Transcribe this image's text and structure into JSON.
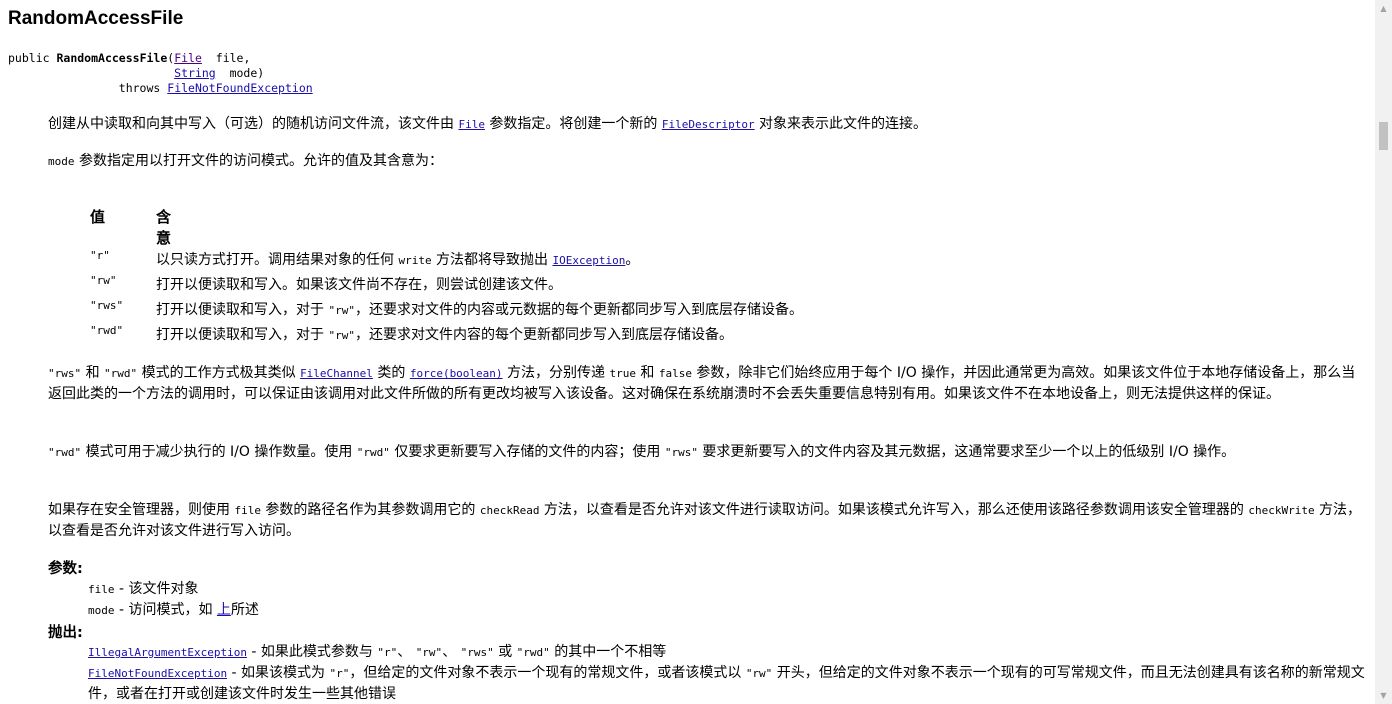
{
  "title": "RandomAccessFile",
  "signature": {
    "modifier": "public",
    "name": "RandomAccessFile",
    "param1_type": "File",
    "param1_name": "file,",
    "param2_type": "String",
    "param2_name": "mode)",
    "throws_kw": "throws",
    "throws_type": "FileNotFoundException"
  },
  "p1": {
    "a": "创建从中读取和向其中写入（可选）的随机访问文件流，该文件由 ",
    "link1": "File",
    "b": " 参数指定。将创建一个新的 ",
    "link2": "FileDescriptor",
    "c": " 对象来表示此文件的连接。"
  },
  "p2": {
    "code": "mode",
    "text": " 参数指定用以打开文件的访问模式。允许的值及其含意为："
  },
  "table": {
    "header_value": "值",
    "header_meaning": "含意",
    "rows": [
      {
        "value": "\"r\"",
        "pre": "以只读方式打开。调用结果对象的任何 ",
        "code": "write",
        "mid": " 方法都将导致抛出 ",
        "link": "IOException",
        "post": "。"
      },
      {
        "value": "\"rw\"",
        "text": "打开以便读取和写入。如果该文件尚不存在，则尝试创建该文件。"
      },
      {
        "value": "\"rws\"",
        "pre": "打开以便读取和写入，对于 ",
        "code": "\"rw\"",
        "post": "，还要求对文件的内容或元数据的每个更新都同步写入到底层存储设备。"
      },
      {
        "value": "\"rwd\"",
        "pre": "打开以便读取和写入，对于 ",
        "code": "\"rw\"",
        "post": "，还要求对文件内容的每个更新都同步写入到底层存储设备。"
      }
    ]
  },
  "p3": {
    "c1": "\"rws\"",
    "t1": " 和 ",
    "c2": "\"rwd\"",
    "t2": " 模式的工作方式极其类似 ",
    "l1": "FileChannel",
    "t3": " 类的 ",
    "l2": "force(boolean)",
    "t4": " 方法，分别传递 ",
    "c3": "true",
    "t5": " 和 ",
    "c4": "false",
    "t6": " 参数，除非它们始终应用于每个 I/O 操作，并因此通常更为高效。如果该文件位于本地存储设备上，那么当返回此类的一个方法的调用时，可以保证由该调用对此文件所做的所有更改均被写入该设备。这对确保在系统崩溃时不会丢失重要信息特别有用。如果该文件不在本地设备上，则无法提供这样的保证。"
  },
  "p4": {
    "c1": "\"rwd\"",
    "t1": " 模式可用于减少执行的 I/O 操作数量。使用 ",
    "c2": "\"rwd\"",
    "t2": " 仅要求更新要写入存储的文件的内容；使用 ",
    "c3": "\"rws\"",
    "t3": " 要求更新要写入的文件内容及其元数据，这通常要求至少一个以上的低级别 I/O 操作。"
  },
  "p5": {
    "t1": "如果存在安全管理器，则使用 ",
    "c1": "file",
    "t2": " 参数的路径名作为其参数调用它的 ",
    "c2": "checkRead",
    "t3": " 方法，以查看是否允许对该文件进行读取访问。如果该模式允许写入，那么还使用该路径参数调用该安全管理器的 ",
    "c3": "checkWrite",
    "t4": " 方法，以查看是否允许对该文件进行写入访问。"
  },
  "params": {
    "label": "参数:",
    "p1_code": "file",
    "p1_text": " - 该文件对象",
    "p2_code": "mode",
    "p2_text": " - 访问模式，如 ",
    "p2_link": "上",
    "p2_after": "所述"
  },
  "throws": {
    "label": "抛出:",
    "e1_link": "IllegalArgumentException",
    "e1_t1": " - 如果此模式参数与 ",
    "e1_c1": "\"r\"",
    "e1_t2": "、 ",
    "e1_c2": "\"rw\"",
    "e1_t3": "、 ",
    "e1_c3": "\"rws\"",
    "e1_t4": " 或 ",
    "e1_c4": "\"rwd\"",
    "e1_t5": " 的其中一个不相等",
    "e2_link": "FileNotFoundException",
    "e2_t1": " - 如果该模式为 ",
    "e2_c1": "\"r\"",
    "e2_t2": "，但给定的文件对象不表示一个现有的常规文件，或者该模式以 ",
    "e2_c2": "\"rw\"",
    "e2_t3": " 开头，但给定的文件对象不表示一个现有的可写常规文件，而且无法创建具有该名称的新常规文件，或者在打开或创建该文件时发生一些其他错误"
  },
  "scrollbar": {
    "up_icon": "triangle-up",
    "down_icon": "triangle-down"
  }
}
